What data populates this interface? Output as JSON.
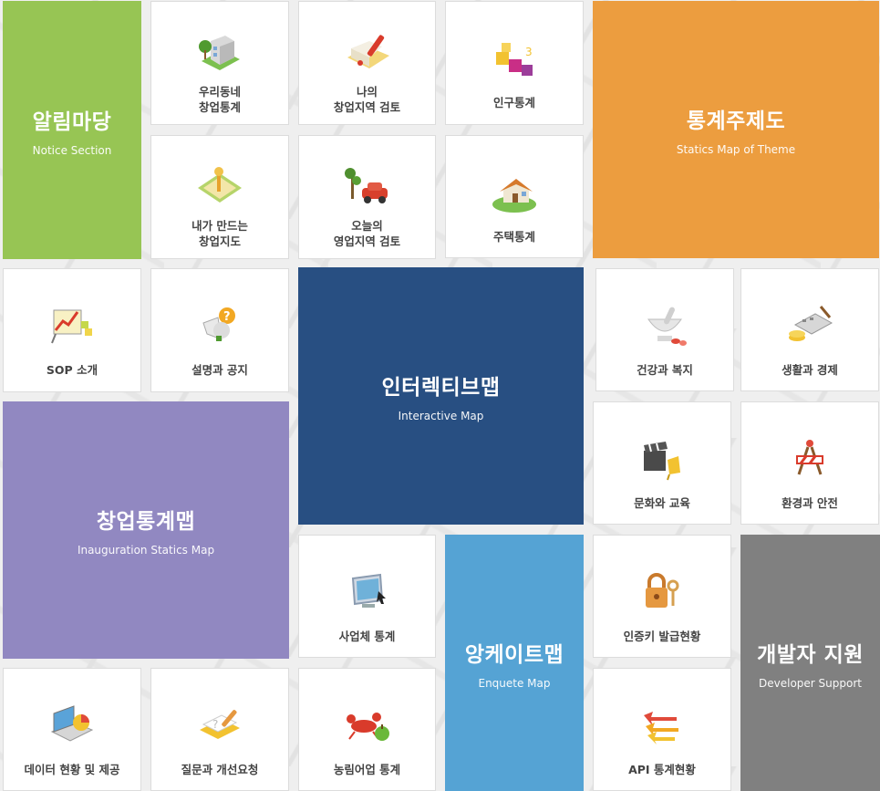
{
  "sections": {
    "notice": {
      "title": "알림마당",
      "subtitle": "Notice Section",
      "color": "#97c554"
    },
    "theme": {
      "title": "통계주제도",
      "subtitle": "Statics Map of Theme",
      "color": "#ec9d3f"
    },
    "interactive": {
      "title": "인터렉티브맵",
      "subtitle": "Interactive Map",
      "color": "#284f82"
    },
    "startup": {
      "title": "창업통계맵",
      "subtitle": "Inauguration Statics Map",
      "color": "#9188c1"
    },
    "enquete": {
      "title": "앙케이트맵",
      "subtitle": "Enquete Map",
      "color": "#55a3d4"
    },
    "developer": {
      "title": "개발자 지원",
      "subtitle": "Developer Support",
      "color": "#808080"
    }
  },
  "tiles": {
    "neighborhood": {
      "label": "우리동네\n창업통계",
      "icon": "neighborhood-building-icon"
    },
    "my_region": {
      "label": "나의\n창업지역 검토",
      "icon": "map-pen-icon"
    },
    "population": {
      "label": "인구통계",
      "icon": "population-blocks-icon"
    },
    "my_map": {
      "label": "내가 만드는\n창업지도",
      "icon": "map-pin-icon"
    },
    "today_region": {
      "label": "오늘의\n영업지역 검토",
      "icon": "car-tree-icon"
    },
    "housing": {
      "label": "주택통계",
      "icon": "house-icon"
    },
    "sop": {
      "label": "SOP 소개",
      "icon": "chart-board-icon"
    },
    "guide": {
      "label": "설명과 공지",
      "icon": "megaphone-question-icon"
    },
    "health": {
      "label": "건강과 복지",
      "icon": "mortar-pestle-icon"
    },
    "living": {
      "label": "생활과 경제",
      "icon": "calculator-coins-icon"
    },
    "culture": {
      "label": "문화와 교육",
      "icon": "clapperboard-icon"
    },
    "environment": {
      "label": "환경과 안전",
      "icon": "road-barrier-icon"
    },
    "business": {
      "label": "사업체 통계",
      "icon": "monitor-cursor-icon"
    },
    "cert_key": {
      "label": "인증키 발급현황",
      "icon": "lock-key-icon"
    },
    "data": {
      "label": "데이터 현황 및 제공",
      "icon": "laptop-pie-icon"
    },
    "qna": {
      "label": "질문과 개선요청",
      "icon": "notepad-pencil-icon"
    },
    "agri": {
      "label": "농림어업 통계",
      "icon": "lobster-apple-icon"
    },
    "api": {
      "label": "API 통계현황",
      "icon": "arrows-icon"
    }
  }
}
